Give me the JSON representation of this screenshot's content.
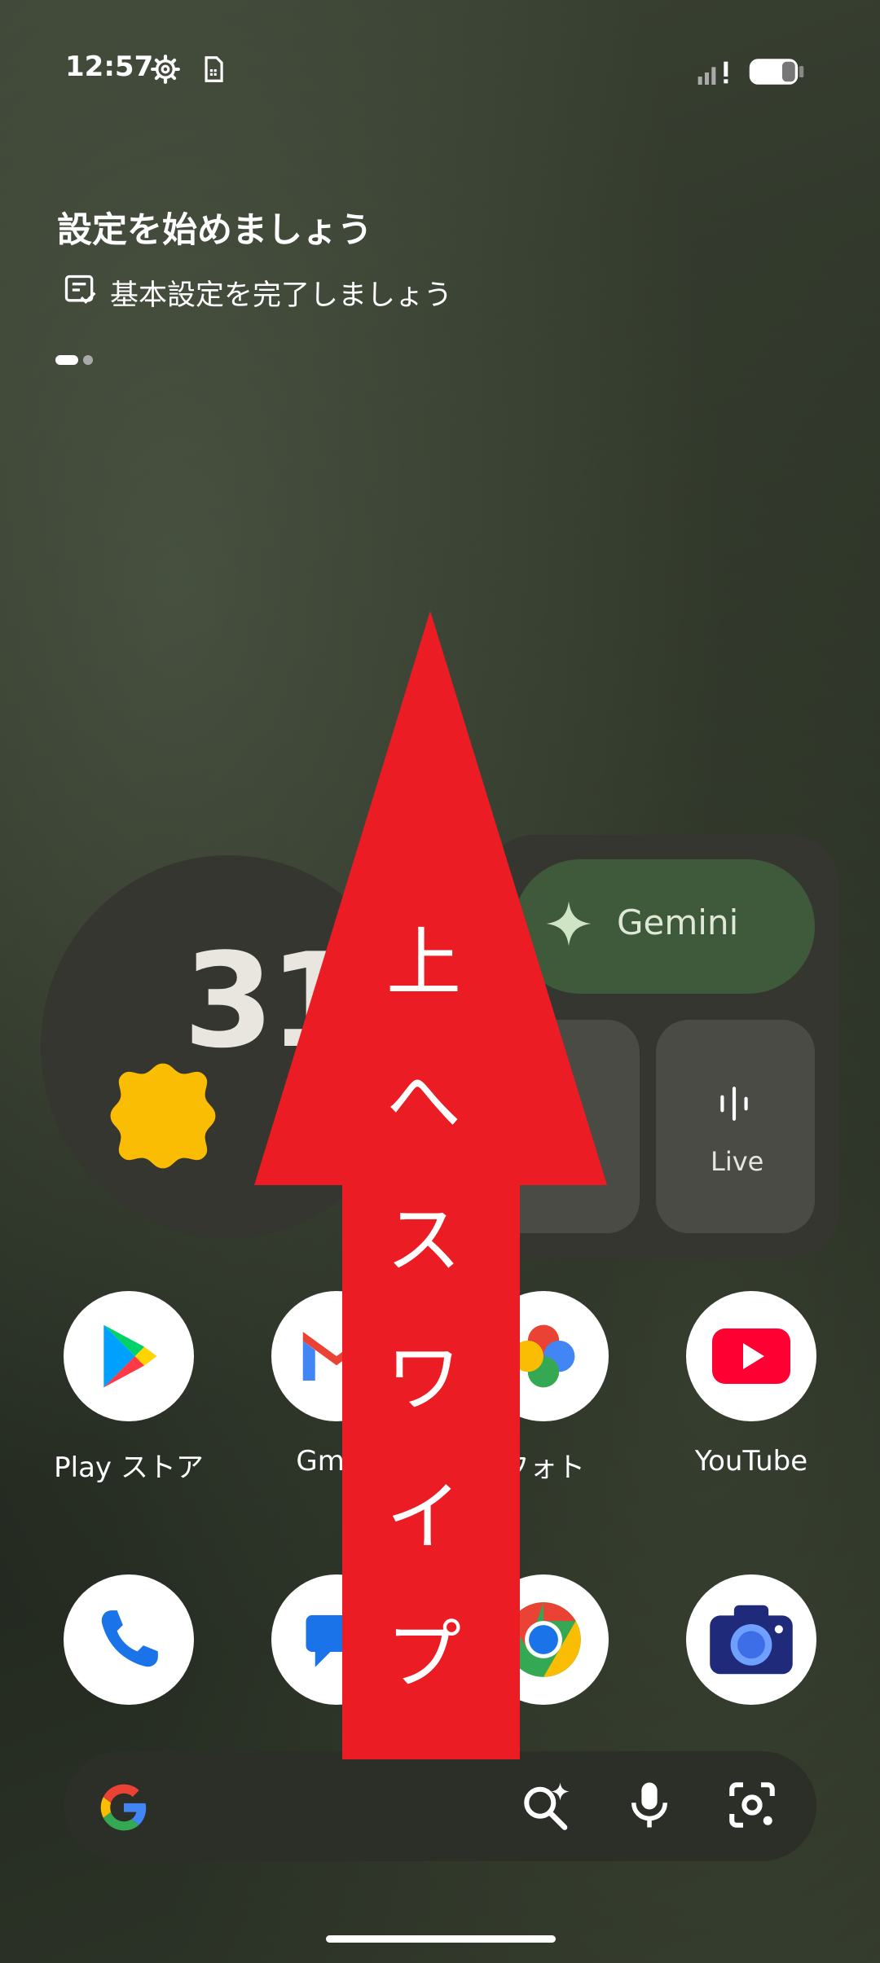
{
  "status_bar": {
    "time": "12:57",
    "left_icons": [
      "gear-icon",
      "sim-card-icon"
    ],
    "right_icons": [
      "signal-alert-icon",
      "battery-icon"
    ]
  },
  "setup_card": {
    "title": "設定を始めましょう",
    "subtitle": "基本設定を完了しましょう",
    "icon": "checklist-icon",
    "pager": {
      "pages": 2,
      "current": 1
    }
  },
  "weather_widget": {
    "temperature": "31°",
    "icon": "sun-icon"
  },
  "gemini_widget": {
    "label": "Gemini",
    "icon": "sparkle-icon",
    "tiles": [
      {
        "label": "",
        "icon": "mic-icon"
      },
      {
        "label": "Live",
        "icon": "live-waveform-icon"
      }
    ]
  },
  "apps_row1": [
    {
      "label": "Play ストア",
      "icon": "play-store-icon"
    },
    {
      "label": "Gmail",
      "icon": "gmail-icon"
    },
    {
      "label": "フォト",
      "icon": "photos-icon"
    },
    {
      "label": "YouTube",
      "icon": "youtube-icon"
    }
  ],
  "apps_row2": [
    {
      "label": "",
      "icon": "phone-icon"
    },
    {
      "label": "",
      "icon": "messages-icon"
    },
    {
      "label": "",
      "icon": "chrome-icon"
    },
    {
      "label": "",
      "icon": "camera-icon"
    }
  ],
  "search_bar": {
    "icons": [
      "google-g-icon",
      "search-sparkle-icon",
      "mic-icon",
      "lens-icon"
    ]
  },
  "overlay": {
    "text_chars": [
      "上",
      "へ",
      "ス",
      "ワ",
      "イ",
      "プ"
    ],
    "color": "#ec1c24"
  },
  "colors": {
    "sun": "#fbbc04",
    "gemini_pill": "#3e5a3a",
    "widget_bg": "#34362f"
  }
}
